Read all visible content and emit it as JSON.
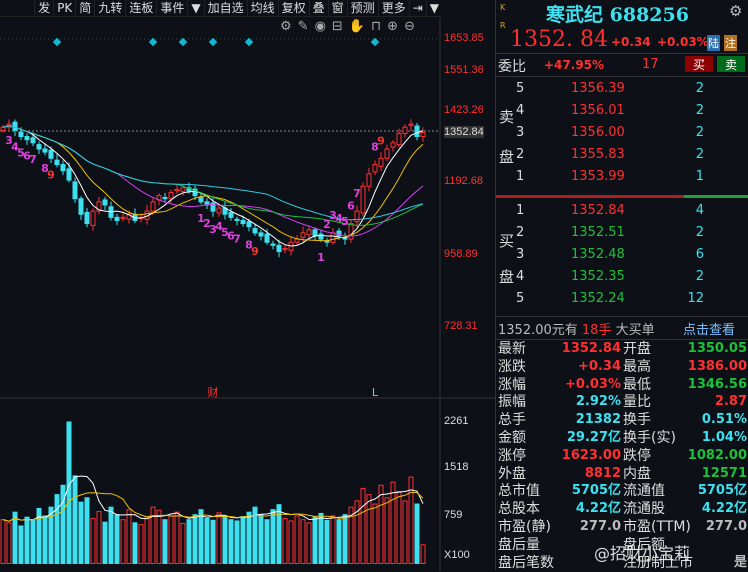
{
  "toolbar": [
    "发",
    "PK",
    "简",
    "九转",
    "连板",
    "事件",
    "▼",
    "加自选",
    "均线",
    "复权",
    "叠",
    "窗",
    "预测",
    "更多",
    "⇥",
    "▼"
  ],
  "tools": [
    {
      "name": "settings-icon",
      "g": "⚙"
    },
    {
      "name": "pen-icon",
      "g": "✎"
    },
    {
      "name": "eye-icon",
      "g": "◉"
    },
    {
      "name": "toolbox-icon",
      "g": "⊟"
    },
    {
      "name": "hand-icon",
      "g": "✋"
    },
    {
      "name": "lock-icon",
      "g": "⊓"
    },
    {
      "name": "zoom-in-icon",
      "g": "⊕"
    },
    {
      "name": "zoom-out-icon",
      "g": "⊖"
    }
  ],
  "price_axis": [
    {
      "v": 1653.85,
      "c": "#ff3030"
    },
    {
      "v": 1551.36,
      "c": "#ff3030"
    },
    {
      "v": 1423.26,
      "c": "#ff3030"
    },
    {
      "v": 1352.84,
      "c": "#ddd"
    },
    {
      "v": 1192.68,
      "c": "#ff3030"
    },
    {
      "v": 958.89,
      "c": "#ff3030"
    },
    {
      "v": 728.31,
      "c": "#ff3030"
    }
  ],
  "vol_axis": [
    "2261",
    "1518",
    "759",
    "X100"
  ],
  "vol_axis_vals": [
    2261,
    1518,
    759
  ],
  "kline_closes": [
    1370,
    1380,
    1360,
    1340,
    1330,
    1320,
    1300,
    1290,
    1270,
    1250,
    1230,
    1200,
    1140,
    1090,
    1060,
    1100,
    1130,
    1120,
    1080,
    1070,
    1080,
    1090,
    1070,
    1080,
    1100,
    1130,
    1150,
    1140,
    1160,
    1170,
    1175,
    1165,
    1150,
    1130,
    1120,
    1100,
    1110,
    1090,
    1080,
    1070,
    1060,
    1050,
    1030,
    1020,
    1000,
    990,
    970,
    980,
    1000,
    1010,
    1030,
    1040,
    1020,
    1010,
    1000,
    1030,
    1020,
    1010,
    1060,
    1100,
    1180,
    1220,
    1250,
    1270,
    1300,
    1320,
    1350,
    1370,
    1380,
    1340,
    1352.84
  ],
  "volumes": [
    700,
    650,
    820,
    600,
    740,
    690,
    880,
    760,
    900,
    1100,
    1250,
    2261,
    1400,
    980,
    1050,
    720,
    830,
    660,
    900,
    780,
    700,
    860,
    650,
    620,
    740,
    900,
    850,
    700,
    760,
    820,
    640,
    700,
    780,
    860,
    720,
    690,
    810,
    760,
    700,
    680,
    750,
    820,
    900,
    780,
    700,
    860,
    940,
    720,
    680,
    760,
    700,
    650,
    740,
    800,
    690,
    760,
    700,
    780,
    900,
    1000,
    1200,
    1100,
    950,
    1250,
    1050,
    1300,
    1150,
    1000,
    1380,
    950,
    300
  ],
  "markers": {
    "diamond_idx": [
      9,
      25,
      30,
      35,
      41,
      62
    ],
    "events": [
      {
        "i": 35,
        "t": "财"
      },
      {
        "i": 62,
        "t": "L"
      }
    ]
  },
  "nine_turn": [
    {
      "i": 1,
      "n": "3"
    },
    {
      "i": 2,
      "n": "4"
    },
    {
      "i": 3,
      "n": "5"
    },
    {
      "i": 4,
      "n": "6"
    },
    {
      "i": 5,
      "n": "7"
    },
    {
      "i": 7,
      "n": "8"
    },
    {
      "i": 8,
      "n": "9"
    },
    {
      "i": 33,
      "n": "1"
    },
    {
      "i": 34,
      "n": "2"
    },
    {
      "i": 35,
      "n": "3"
    },
    {
      "i": 36,
      "n": "4"
    },
    {
      "i": 37,
      "n": "5"
    },
    {
      "i": 38,
      "n": "6"
    },
    {
      "i": 39,
      "n": "7"
    },
    {
      "i": 41,
      "n": "8"
    },
    {
      "i": 42,
      "n": "9"
    },
    {
      "i": 53,
      "n": "1"
    },
    {
      "i": 54,
      "n": "2"
    },
    {
      "i": 55,
      "n": "3"
    },
    {
      "i": 56,
      "n": "4"
    },
    {
      "i": 57,
      "n": "5"
    },
    {
      "i": 58,
      "n": "6"
    },
    {
      "i": 59,
      "n": "7"
    },
    {
      "i": 62,
      "n": "8"
    },
    {
      "i": 63,
      "n": "9"
    }
  ],
  "quote": {
    "name": "寒武纪",
    "code": "688256",
    "price": "1352. 84",
    "chg": "+0.34",
    "pct": "+0.03%",
    "tag1": "陆",
    "tag2": "注",
    "wb_label": "委比",
    "wb": "+47.95%",
    "wc": "17",
    "buy": "买",
    "sell": "卖"
  },
  "asks_label": [
    "卖",
    "盘"
  ],
  "bids_label": [
    "买",
    "盘"
  ],
  "asks": [
    {
      "l": "5",
      "p": "1356.39",
      "v": "2"
    },
    {
      "l": "4",
      "p": "1356.01",
      "v": "2"
    },
    {
      "l": "3",
      "p": "1356.00",
      "v": "2"
    },
    {
      "l": "2",
      "p": "1355.83",
      "v": "2"
    },
    {
      "l": "1",
      "p": "1353.99",
      "v": "1"
    }
  ],
  "bids": [
    {
      "l": "1",
      "p": "1352.84",
      "v": "4"
    },
    {
      "l": "2",
      "p": "1352.51",
      "v": "2"
    },
    {
      "l": "3",
      "p": "1352.48",
      "v": "6"
    },
    {
      "l": "4",
      "p": "1352.35",
      "v": "2"
    },
    {
      "l": "5",
      "p": "1352.24",
      "v": "12"
    }
  ],
  "bigorder": {
    "a": "1352.00元有",
    "b": "18手",
    "c": "大买单",
    "link": "点击查看"
  },
  "stats": [
    [
      "最新",
      "1352.84",
      "red",
      "开盘",
      "1350.05",
      "grn"
    ],
    [
      "涨跌",
      "+0.34",
      "red",
      "最高",
      "1386.00",
      "red"
    ],
    [
      "涨幅",
      "+0.03%",
      "red",
      "最低",
      "1346.56",
      "grn"
    ],
    [
      "振幅",
      "2.92%",
      "cyn",
      "量比",
      "2.87",
      "red"
    ],
    [
      "总手",
      "21382",
      "cyn",
      "换手",
      "0.51%",
      "cyn"
    ],
    [
      "金额",
      "29.27亿",
      "cyn",
      "换手(实)",
      "1.04%",
      "cyn"
    ],
    [
      "涨停",
      "1623.00",
      "red",
      "跌停",
      "1082.00",
      "grn"
    ],
    [
      "外盘",
      "8812",
      "red",
      "内盘",
      "12571",
      "grn"
    ],
    [
      "总市值",
      "5705亿",
      "cyn",
      "流通值",
      "5705亿",
      "cyn"
    ],
    [
      "总股本",
      "4.22亿",
      "cyn",
      "流通股",
      "4.22亿",
      "cyn"
    ],
    [
      "市盈(静)",
      "277.0",
      "gry",
      "市盈(TTM)",
      "277.0",
      "gry"
    ],
    [
      "盘后量",
      "",
      "gry",
      "盘后额",
      "",
      "gry"
    ],
    [
      "盘后笔数",
      "",
      "gry",
      "注册制上市",
      "是",
      "gry"
    ]
  ],
  "watermark": "@招财小宝莉"
}
